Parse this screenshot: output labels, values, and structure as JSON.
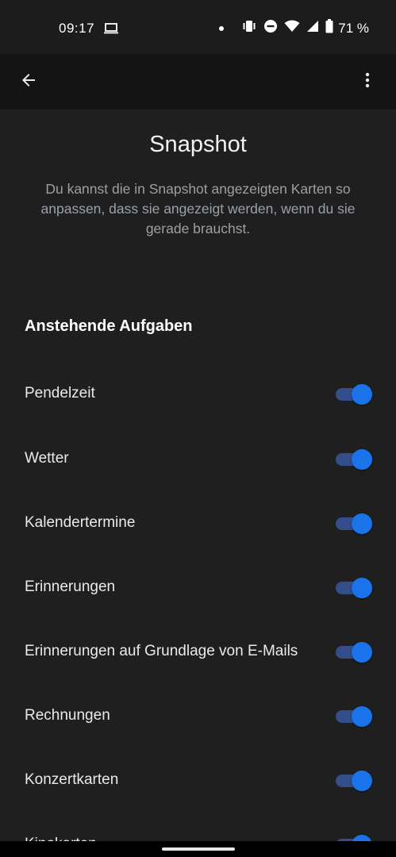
{
  "status_bar": {
    "time": "09:17",
    "battery_percent": "71 %",
    "icons": [
      "laptop-icon",
      "notification-dot-icon",
      "vibrate-icon",
      "do-not-disturb-icon",
      "wifi-icon",
      "cell-signal-icon",
      "battery-icon"
    ]
  },
  "toolbar": {
    "back_icon": "arrow-back-icon",
    "more_icon": "more-vert-icon"
  },
  "header": {
    "title": "Snapshot",
    "description": "Du kannst die in Snapshot angezeigten Karten so anpassen, dass sie angezeigt werden, wenn du sie gerade brauchst."
  },
  "section": {
    "title": "Anstehende Aufgaben",
    "items": [
      {
        "label": "Pendelzeit",
        "enabled": true
      },
      {
        "label": "Wetter",
        "enabled": true
      },
      {
        "label": "Kalendertermine",
        "enabled": true
      },
      {
        "label": "Erinnerungen",
        "enabled": true
      },
      {
        "label": "Erinnerungen auf Grundlage von E-Mails",
        "enabled": true
      },
      {
        "label": "Rechnungen",
        "enabled": true
      },
      {
        "label": "Konzertkarten",
        "enabled": true
      },
      {
        "label": "Kinokarten",
        "enabled": true
      }
    ]
  },
  "colors": {
    "background": "#1f1f20",
    "toolbar": "#141414",
    "accent": "#1a73e8",
    "toggle_track": "#334e8a"
  }
}
